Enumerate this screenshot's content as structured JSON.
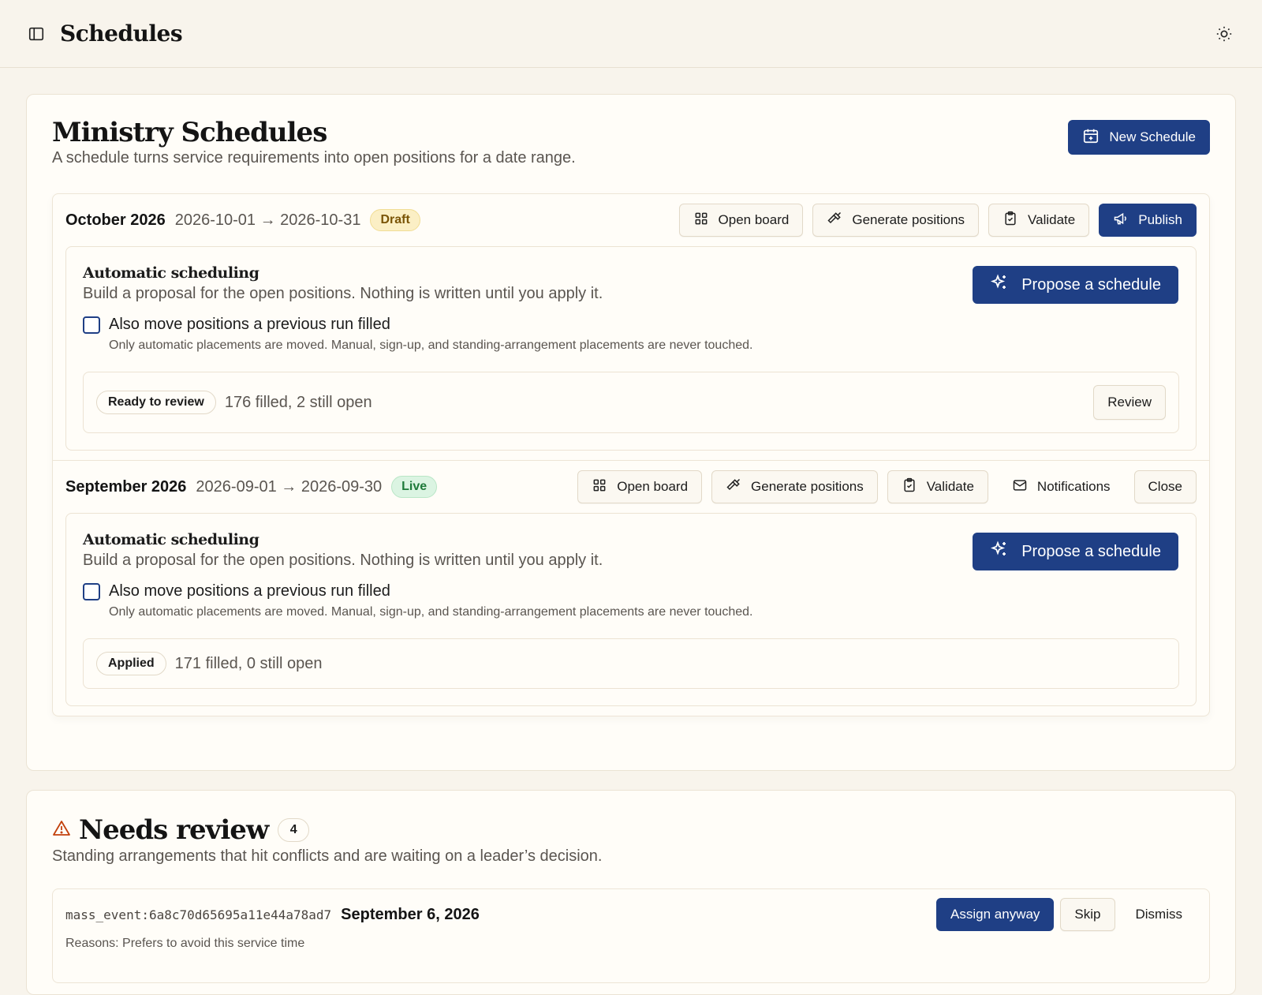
{
  "app": {
    "title": "Schedules"
  },
  "main": {
    "title": "Ministry Schedules",
    "subtitle": "A schedule turns service requirements into open positions for a date range.",
    "new_button": "New Schedule"
  },
  "schedules": [
    {
      "name": "October 2026",
      "range": "2026-10-01 → 2026-10-31",
      "status": "Draft",
      "actions": {
        "open_board": "Open board",
        "generate": "Generate positions",
        "validate": "Validate",
        "publish": "Publish"
      },
      "auto": {
        "title": "Automatic scheduling",
        "desc": "Build a proposal for the open positions. Nothing is written until you apply it.",
        "propose": "Propose a schedule",
        "checkbox_label": "Also move positions a previous run filled",
        "checkbox_help": "Only automatic placements are moved. Manual, sign-up, and standing-arrangement placements are never touched.",
        "result_status": "Ready to review",
        "result_text": "176 filled, 2 still open",
        "review_button": "Review"
      }
    },
    {
      "name": "September 2026",
      "range": "2026-09-01 → 2026-09-30",
      "status": "Live",
      "actions": {
        "open_board": "Open board",
        "generate": "Generate positions",
        "validate": "Validate",
        "notifications": "Notifications",
        "close": "Close"
      },
      "auto": {
        "title": "Automatic scheduling",
        "desc": "Build a proposal for the open positions. Nothing is written until you apply it.",
        "propose": "Propose a schedule",
        "checkbox_label": "Also move positions a previous run filled",
        "checkbox_help": "Only automatic placements are moved. Manual, sign-up, and standing-arrangement placements are never touched.",
        "result_status": "Applied",
        "result_text": "171 filled, 0 still open"
      }
    }
  ],
  "needs_review": {
    "title": "Needs review",
    "count": "4",
    "subtitle": "Standing arrangements that hit conflicts and are waiting on a leader’s decision.",
    "items": [
      {
        "event_id": "mass_event:6a8c70d65695a11e44a78ad7",
        "date": "September 6, 2026",
        "reasons": "Reasons: Prefers to avoid this service time",
        "assign": "Assign anyway",
        "skip": "Skip",
        "dismiss": "Dismiss"
      }
    ]
  },
  "colors": {
    "primary": "#1f3f85",
    "background": "#f8f4ec",
    "draft": "#fbefc5",
    "live": "#dbf4e2",
    "warning": "#c2410c"
  }
}
